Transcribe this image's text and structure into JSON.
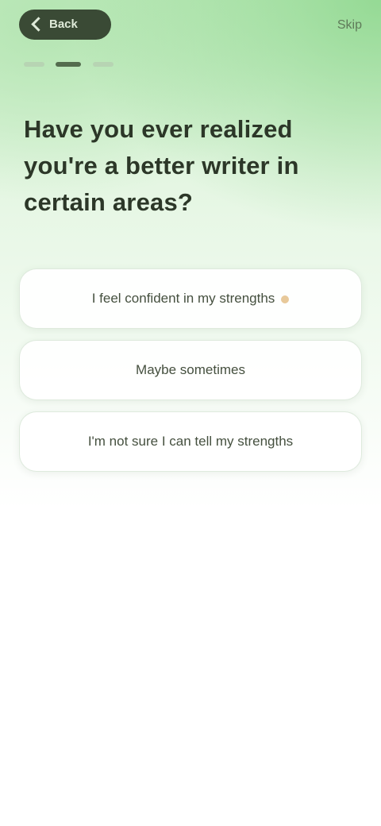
{
  "header": {
    "back_label": "Back",
    "skip_label": "Skip"
  },
  "progress": {
    "total_steps": 3,
    "current_step": 2
  },
  "question": {
    "text": "Have you ever realized you're a better writer in certain areas?"
  },
  "options": [
    {
      "label": "I feel confident in my strengths"
    },
    {
      "label": "Maybe sometimes"
    },
    {
      "label": "I'm not sure I can tell my strengths"
    }
  ],
  "colors": {
    "accent_green": "#8cd68c",
    "pill_dark": "#3a4a35",
    "text_dark": "#2c3728"
  },
  "icons": {
    "back": "chevron-left-icon"
  }
}
